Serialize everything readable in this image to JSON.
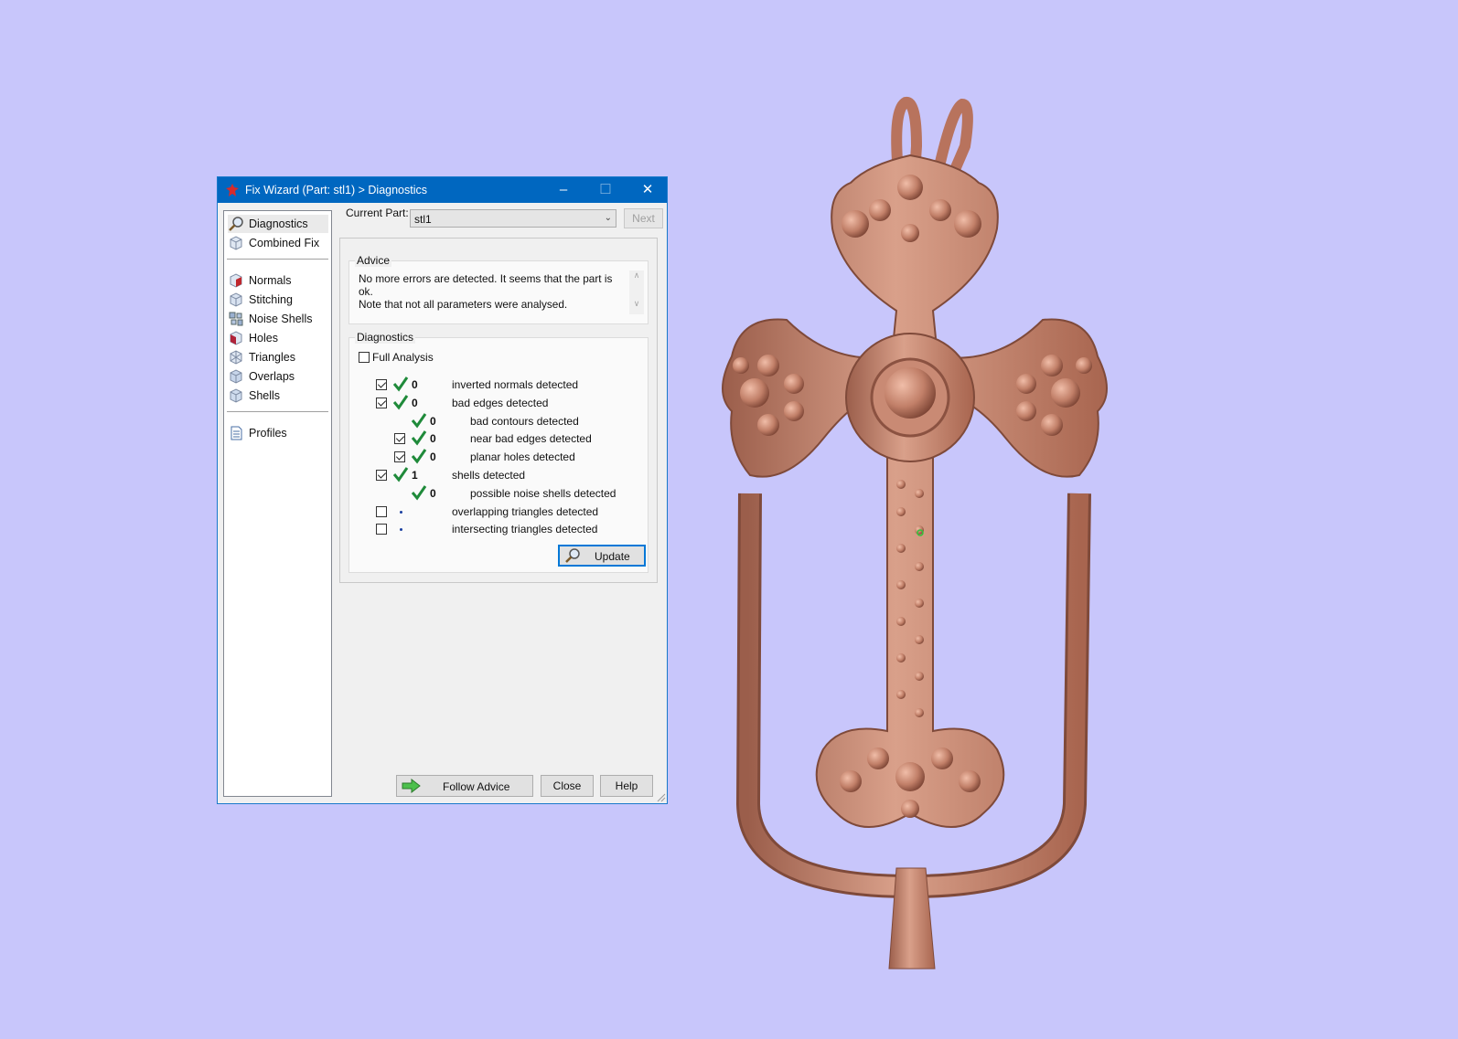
{
  "window": {
    "title": "Fix Wizard (Part: stl1) > Diagnostics",
    "minimize_glyph": "–",
    "maximize_glyph": "☐",
    "close_glyph": "✕"
  },
  "nav": {
    "items": [
      {
        "label": "Diagnostics",
        "icon": "magnifier-icon"
      },
      {
        "label": "Combined Fix",
        "icon": "cube-icon"
      },
      {
        "label": "Normals",
        "icon": "normals-cube-icon"
      },
      {
        "label": "Stitching",
        "icon": "stitching-cube-icon"
      },
      {
        "label": "Noise Shells",
        "icon": "noise-shells-icon"
      },
      {
        "label": "Holes",
        "icon": "holes-cube-icon"
      },
      {
        "label": "Triangles",
        "icon": "triangles-cube-icon"
      },
      {
        "label": "Overlaps",
        "icon": "overlaps-cube-icon"
      },
      {
        "label": "Shells",
        "icon": "shells-cube-icon"
      },
      {
        "label": "Profiles",
        "icon": "document-icon"
      }
    ]
  },
  "current_part": {
    "label": "Current Part:",
    "value": "stl1"
  },
  "next_button": "Next",
  "advice": {
    "title": "Advice",
    "line1": "No more errors are detected. It seems that the part is ok.",
    "line2": "Note that not all parameters were analysed."
  },
  "diagnostics": {
    "title": "Diagnostics",
    "full_analysis_label": "Full Analysis",
    "rows": [
      {
        "checkbox": true,
        "checked": true,
        "status": "ok",
        "count": "0",
        "label": "inverted normals detected"
      },
      {
        "checkbox": true,
        "checked": true,
        "status": "ok",
        "count": "0",
        "label": "bad edges detected"
      },
      {
        "checkbox": false,
        "checked": false,
        "status": "ok",
        "count": "0",
        "label": "bad contours detected"
      },
      {
        "checkbox": true,
        "checked": true,
        "status": "ok",
        "count": "0",
        "label": "near bad edges detected"
      },
      {
        "checkbox": true,
        "checked": true,
        "status": "ok",
        "count": "0",
        "label": "planar holes detected"
      },
      {
        "checkbox": true,
        "checked": true,
        "status": "ok",
        "count": "1",
        "label": "shells detected"
      },
      {
        "checkbox": false,
        "checked": false,
        "status": "ok",
        "count": "0",
        "label": "possible noise shells detected"
      },
      {
        "checkbox": true,
        "checked": false,
        "status": "pending",
        "count": "",
        "label": "overlapping triangles detected"
      },
      {
        "checkbox": true,
        "checked": false,
        "status": "pending",
        "count": "",
        "label": "intersecting triangles detected"
      }
    ],
    "update_button": "Update"
  },
  "footer": {
    "follow_advice": "Follow Advice",
    "close": "Close",
    "help": "Help"
  },
  "colors": {
    "background": "#c8c6fb",
    "titlebar": "#0067c0",
    "model": "#c98a74",
    "check_green": "#1f8a3a"
  }
}
